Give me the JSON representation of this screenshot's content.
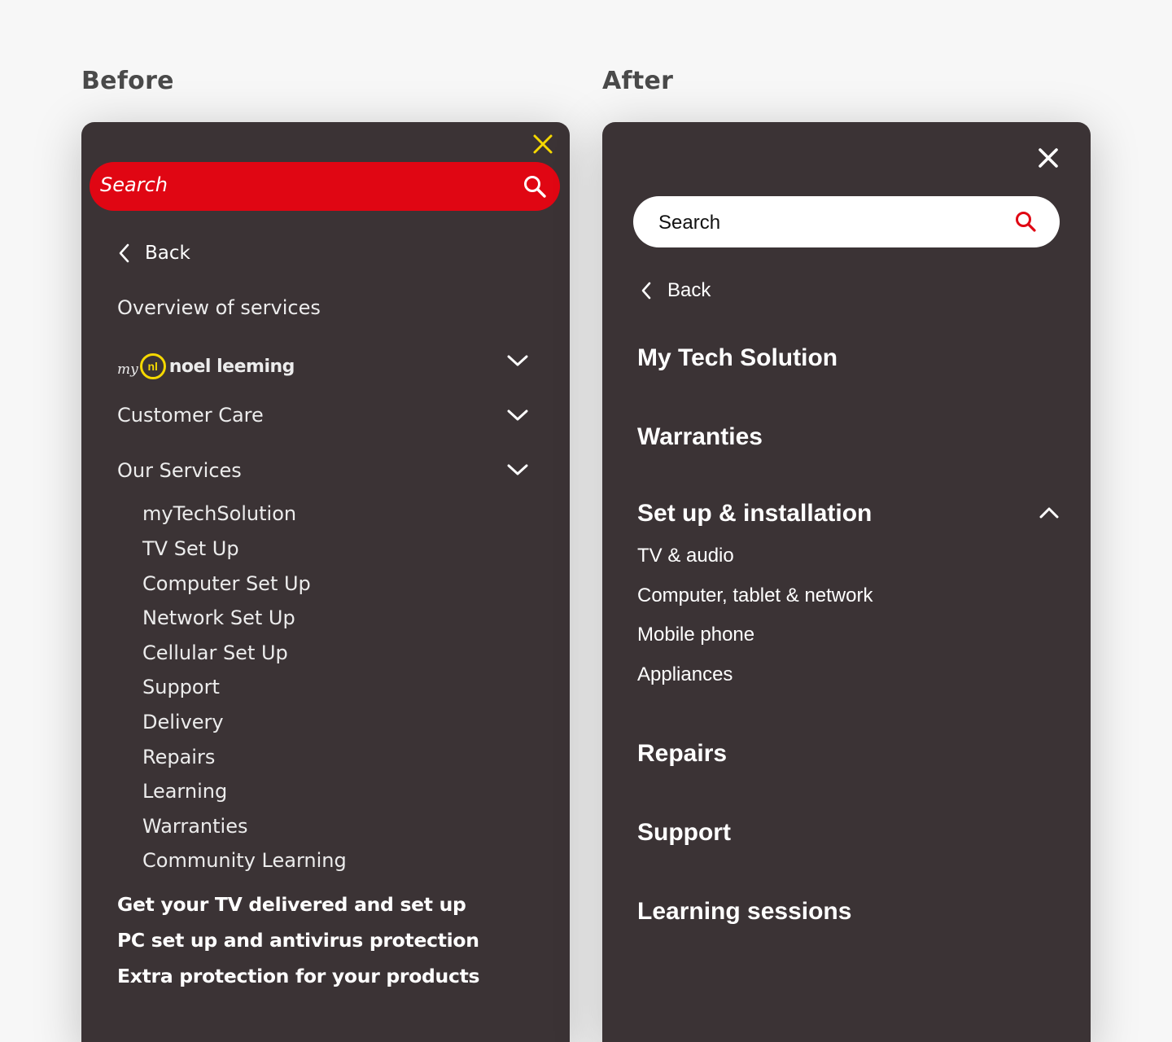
{
  "headings": {
    "before": "Before",
    "after": "After"
  },
  "before": {
    "search": {
      "placeholder": "Search"
    },
    "back_label": "Back",
    "overview": "Overview of services",
    "logo": {
      "prefix": "my",
      "mark": "nl",
      "brand": "noel leeming"
    },
    "customer_care": "Customer Care",
    "our_services": "Our Services",
    "sub_items": [
      "myTechSolution",
      "TV Set Up",
      "Computer Set Up",
      "Network Set Up",
      "Cellular Set Up",
      "Support",
      "Delivery",
      "Repairs",
      "Learning",
      "Warranties",
      "Community Learning"
    ],
    "promos": [
      "Get your TV delivered and set up",
      "PC set up and antivirus protection",
      "Extra protection for your products"
    ],
    "colors": {
      "search_bg": "#e00613",
      "close": "#f5d800",
      "logo_accent": "#f5d800"
    }
  },
  "after": {
    "search": {
      "placeholder": "Search"
    },
    "back_label": "Back",
    "items": {
      "my_tech": "My Tech Solution",
      "warranties": "Warranties",
      "setup": "Set up & installation",
      "setup_children": [
        "TV & audio",
        "Computer, tablet & network",
        "Mobile phone",
        "Appliances"
      ],
      "repairs": "Repairs",
      "support": "Support",
      "learning": "Learning sessions"
    },
    "colors": {
      "search_icon": "#e00613",
      "panel_bg": "#3b3335"
    }
  }
}
